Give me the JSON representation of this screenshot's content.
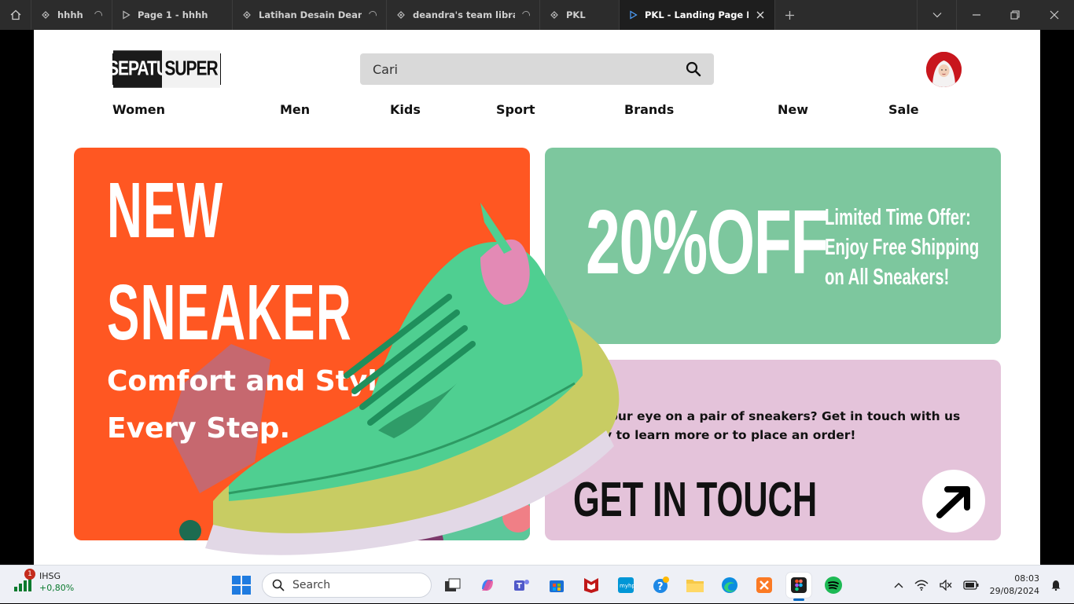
{
  "browser": {
    "tabs": [
      {
        "label": "hhhh",
        "icon": "figma-file-icon",
        "loading": true,
        "active": false
      },
      {
        "label": "Page 1 - hhhh",
        "icon": "play-icon",
        "loading": false,
        "active": false
      },
      {
        "label": "Latihan Desain Deandra",
        "icon": "figma-file-icon",
        "loading": true,
        "active": false
      },
      {
        "label": "deandra's team library",
        "icon": "figma-file-icon",
        "loading": true,
        "active": false
      },
      {
        "label": "PKL",
        "icon": "figma-file-icon",
        "loading": false,
        "active": false
      },
      {
        "label": "PKL - Landing Page Bus",
        "icon": "play-icon",
        "loading": false,
        "active": true
      }
    ]
  },
  "site": {
    "logo_left": "SEPATU",
    "logo_right": "SUPER",
    "search_placeholder": "Cari",
    "nav": [
      "Women",
      "Men",
      "Kids",
      "Sport",
      "Brands",
      "New",
      "Sale"
    ]
  },
  "hero": {
    "title_line1": "NEW",
    "title_line2": "SNEAKER",
    "subtitle": "Comfort and Style in Every Step."
  },
  "offer": {
    "big": "20%OFF",
    "line1": "Limited Time Offer:",
    "line2": "Enjoy Free Shipping",
    "line3": "on All Sneakers!"
  },
  "contact": {
    "description": "Got your eye on a pair of sneakers? Get in touch with us today to learn more or to place an order!",
    "cta": "GET IN TOUCH"
  },
  "colors": {
    "hero_bg": "#ff5722",
    "offer_bg": "#7dc79e",
    "contact_bg": "#e4c3da",
    "tab_bar": "#2c2c2c"
  },
  "taskbar": {
    "widget_name": "IHSG",
    "widget_change": "+0,80%",
    "widget_badge": "1",
    "search_label": "Search",
    "time": "08:03",
    "date": "29/08/2024"
  }
}
